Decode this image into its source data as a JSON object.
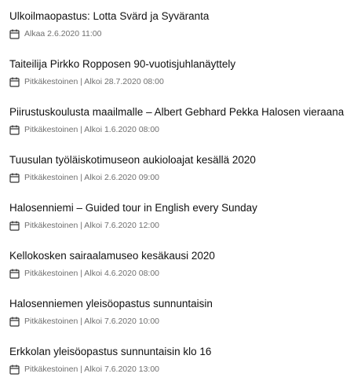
{
  "events": [
    {
      "title": "Ulkoilmaopastus: Lotta Svärd ja Syväranta",
      "date": "Alkaa 2.6.2020 11:00",
      "icon": "calendar-icon"
    },
    {
      "title": "Taiteilija Pirkko Ropposen 90-vuotisjuhlanäyttely",
      "date": "Pitkäkestoinen | Alkoi 28.7.2020 08:00",
      "icon": "calendar-icon"
    },
    {
      "title": "Piirustuskoulusta maailmalle – Albert Gebhard Pekka Halosen vieraana",
      "date": "Pitkäkestoinen | Alkoi 1.6.2020 08:00",
      "icon": "calendar-icon"
    },
    {
      "title": "Tuusulan työläiskotimuseon aukioloajat kesällä 2020",
      "date": "Pitkäkestoinen | Alkoi 2.6.2020 09:00",
      "icon": "calendar-icon"
    },
    {
      "title": "Halosenniemi – Guided tour in English every Sunday",
      "date": "Pitkäkestoinen | Alkoi 7.6.2020 12:00",
      "icon": "calendar-icon"
    },
    {
      "title": "Kellokosken sairaalamuseo kesäkausi 2020",
      "date": "Pitkäkestoinen | Alkoi 4.6.2020 08:00",
      "icon": "calendar-icon"
    },
    {
      "title": "Halosenniemen yleisöopastus sunnuntaisin",
      "date": "Pitkäkestoinen | Alkoi 7.6.2020 10:00",
      "icon": "calendar-icon"
    },
    {
      "title": "Erkkolan yleisöopastus sunnuntaisin klo 16",
      "date": "Pitkäkestoinen | Alkoi 7.6.2020 13:00",
      "icon": "calendar-icon"
    }
  ],
  "colors": {
    "title": "#111111",
    "meta": "#6f6f6f",
    "icon": "#333333",
    "background": "#ffffff"
  }
}
